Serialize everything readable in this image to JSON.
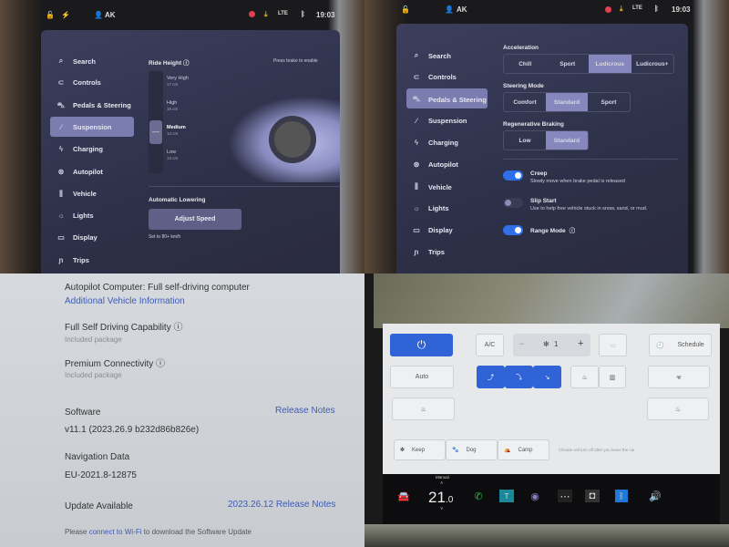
{
  "status": {
    "user": "AK",
    "time": "19:03",
    "network": "LTE"
  },
  "menu": [
    "Search",
    "Controls",
    "Pedals & Steering",
    "Suspension",
    "Charging",
    "Autopilot",
    "Vehicle",
    "Lights",
    "Display",
    "Trips"
  ],
  "menu_icons": [
    "search-icon",
    "toggle-icon",
    "car-icon",
    "suspension-icon",
    "bolt-icon",
    "steering-wheel-icon",
    "sliders-icon",
    "sun-icon",
    "display-icon",
    "route-icon"
  ],
  "suspension": {
    "selected_menu": "Suspension",
    "ride_height_label": "Ride Height",
    "brake_hint": "Press brake to enable",
    "levels": [
      {
        "name": "Very High",
        "value": "17 cm"
      },
      {
        "name": "High",
        "value": "16 cm"
      },
      {
        "name": "Medium",
        "value": "14 cm"
      },
      {
        "name": "Low",
        "value": "13 cm"
      }
    ],
    "selected_level": "Medium",
    "auto_lowering_label": "Automatic Lowering",
    "adjust_button": "Adjust Speed",
    "adjust_note": "Set to 80+ km/h"
  },
  "pedals": {
    "selected_menu": "Pedals & Steering",
    "acceleration": {
      "label": "Acceleration",
      "options": [
        "Chill",
        "Sport",
        "Ludicrous",
        "Ludicrous+"
      ],
      "selected": "Ludicrous"
    },
    "steering": {
      "label": "Steering Mode",
      "options": [
        "Comfort",
        "Standard",
        "Sport"
      ],
      "selected": "Standard"
    },
    "regen": {
      "label": "Regenerative Braking",
      "options": [
        "Low",
        "Standard"
      ],
      "selected": "Standard"
    },
    "toggles": [
      {
        "title": "Creep",
        "desc": "Slowly move when brake pedal is released",
        "on": true
      },
      {
        "title": "Slip Start",
        "desc": "Use to help free vehicle stuck in snow, sand, or mud.",
        "on": false
      },
      {
        "title": "Range Mode",
        "desc": "",
        "on": true
      }
    ]
  },
  "software": {
    "autopilot": "Autopilot Computer: Full self-driving computer",
    "additional_link": "Additional Vehicle Information",
    "fsd_title": "Full Self Driving Capability",
    "fsd_sub": "Included package",
    "pc_title": "Premium Connectivity",
    "pc_sub": "Included package",
    "software_label": "Software",
    "release_notes": "Release Notes",
    "version": "v11.1 (2023.26.9 b232d86b826e)",
    "nav_label": "Navigation Data",
    "nav_value": "EU-2021.8-12875",
    "update_label": "Update Available",
    "update_link": "2023.26.12 Release Notes",
    "wifi_pre": "Please ",
    "wifi_link": "connect to Wi-Fi",
    "wifi_post": " to download the Software Update"
  },
  "climate": {
    "ac": "A/C",
    "fan_minus": "−",
    "fan_level": "1",
    "fan_plus": "+",
    "schedule": "Schedule",
    "auto": "Auto",
    "modes": [
      "Keep",
      "Dog",
      "Camp"
    ],
    "mode_note": "Climate will turn off after you leave the car",
    "temp_mode": "Manual",
    "temp": "21",
    "temp_dec": ".0",
    "accent": "#2f63d6"
  }
}
